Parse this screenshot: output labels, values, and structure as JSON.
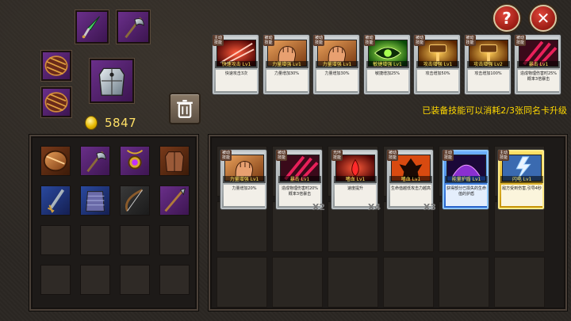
{
  "colors": {
    "gold_text": "#ffe066",
    "hint_yellow": "#ffd800",
    "close_red": "#c9281e",
    "slot_purple": "#5a2478"
  },
  "header": {
    "help_label": "?",
    "close_label": "✕"
  },
  "equipment": {
    "slots": [
      {
        "icon": "green-dagger-icon"
      },
      {
        "icon": "battle-axe-icon"
      },
      {
        "icon": "striped-shield-icon"
      },
      {
        "icon": "plate-armor-icon"
      },
      {
        "icon": "striped-shield-icon"
      }
    ],
    "gold_amount": "5847"
  },
  "hint": {
    "prefix": "已装备技能可以消耗",
    "fraction": "2/3",
    "suffix": "张同名卡升级"
  },
  "equipped_skills": [
    {
      "tag": "主动 技能",
      "name": "快速攻击 Lv1",
      "desc": "快速攻击3次",
      "art": "red-slash"
    },
    {
      "tag": "被动 技能",
      "name": "力量增强 Lv1",
      "desc": "力量增加30%",
      "art": "fist"
    },
    {
      "tag": "被动 技能",
      "name": "力量增强 Lv1",
      "desc": "力量增加30%",
      "art": "fist"
    },
    {
      "tag": "被动 技能",
      "name": "敏捷增强 Lv1",
      "desc": "敏捷增加25%",
      "art": "green-eye"
    },
    {
      "tag": "被动 技能",
      "name": "攻击增强 Lv1",
      "desc": "攻击增加50%",
      "art": "hammer"
    },
    {
      "tag": "被动 技能",
      "name": "攻击增强 Lv2",
      "desc": "攻击增加100%",
      "art": "hammer"
    },
    {
      "tag": "被动 技能",
      "name": "暴击 Lv1",
      "desc": "造成物理伤害时25%概率3倍暴击",
      "art": "red-claw"
    }
  ],
  "inventory_items": [
    {
      "icon": "orange-shield-icon"
    },
    {
      "icon": "battle-axe-icon"
    },
    {
      "icon": "amulet-icon"
    },
    {
      "icon": "plate-armor-icon"
    },
    {
      "icon": "blue-sword-icon"
    },
    {
      "icon": "chainmail-icon"
    },
    {
      "icon": "bow-icon"
    },
    {
      "icon": "spear-icon"
    }
  ],
  "owned_skills": [
    {
      "tag": "被动 技能",
      "name": "力量增强 Lv1",
      "desc": "力量增加20%",
      "art": "fist",
      "count": "",
      "style": "gray"
    },
    {
      "tag": "被动 技能",
      "name": "暴击 Lv1",
      "desc": "造成物理伤害时20%概率3倍暴击",
      "art": "red-claw",
      "count": "X2",
      "style": "gray"
    },
    {
      "tag": "光环 技能",
      "name": "嗜血 Lv1",
      "desc": "速度提升",
      "art": "blood",
      "count": "X4",
      "style": "gray"
    },
    {
      "tag": "被动 技能",
      "name": "嗜血 Lv1",
      "desc": "生命值越低攻击力越高",
      "art": "rage",
      "count": "X3",
      "style": "gray"
    },
    {
      "tag": "主动 技能",
      "name": "能量护盾 Lv1",
      "desc": "获得部分已损失的生命值的护盾",
      "art": "purple-dome",
      "count": "",
      "style": "blue"
    },
    {
      "tag": "主动 技能",
      "name": "闪电 Lv1",
      "desc": "敌方受到伤害,引导4秒",
      "art": "lightning",
      "count": "",
      "style": "gold"
    }
  ]
}
